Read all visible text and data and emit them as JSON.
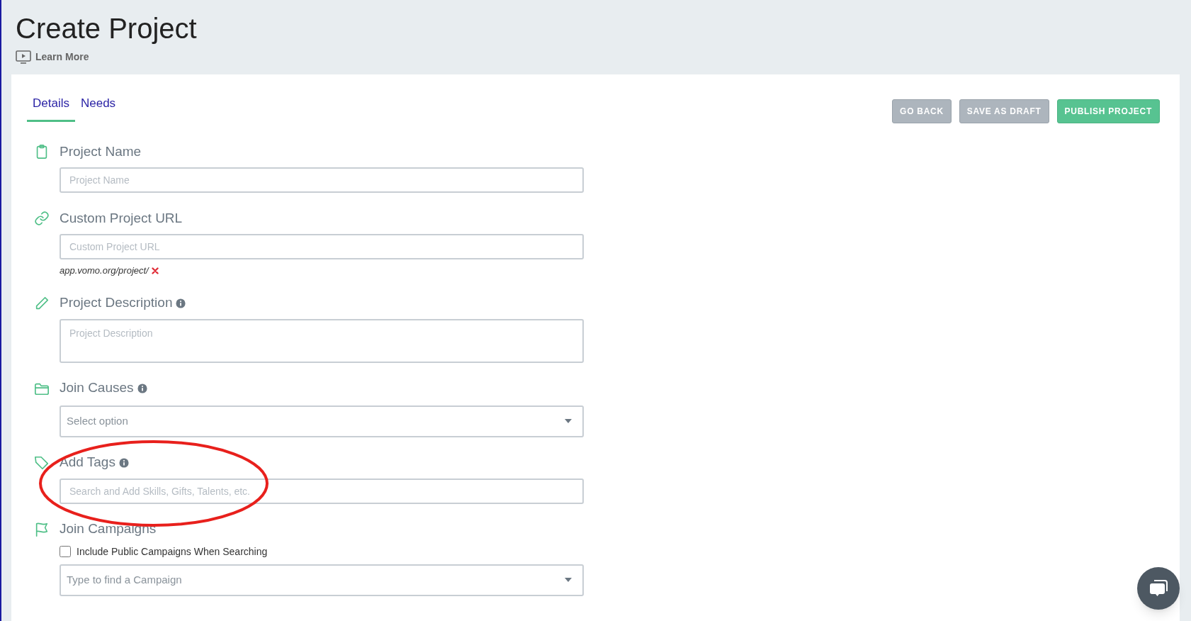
{
  "page": {
    "title": "Create Project",
    "learn_more": "Learn More"
  },
  "tabs": [
    {
      "label": "Details",
      "selected": true
    },
    {
      "label": "Needs",
      "selected": false
    }
  ],
  "actions": [
    {
      "label": "GO BACK",
      "kind": "secondary"
    },
    {
      "label": "SAVE AS DRAFT",
      "kind": "secondary"
    },
    {
      "label": "PUBLISH PROJECT",
      "kind": "primary"
    }
  ],
  "fields": [
    {
      "kind": "text",
      "label": "Project Name",
      "info": false,
      "placeholder": "Project Name"
    },
    {
      "kind": "text",
      "label": "Custom Project URL",
      "info": false,
      "placeholder": "Custom Project URL",
      "hint": "app.vomo.org/project/",
      "hint_invalid": true
    },
    {
      "kind": "textarea",
      "label": "Project Description",
      "info": true,
      "placeholder": "Project Description"
    },
    {
      "kind": "select",
      "label": "Join Causes",
      "info": true,
      "placeholder": "Select option"
    },
    {
      "kind": "text",
      "label": "Add Tags",
      "info": true,
      "placeholder": "Search and Add Skills, Gifts, Talents, etc."
    },
    {
      "kind": "select",
      "label": "Join Campaigns",
      "info": false,
      "checkbox": {
        "label": "Include Public Campaigns When Searching",
        "checked": false
      },
      "placeholder": "Type to find a Campaign"
    }
  ]
}
